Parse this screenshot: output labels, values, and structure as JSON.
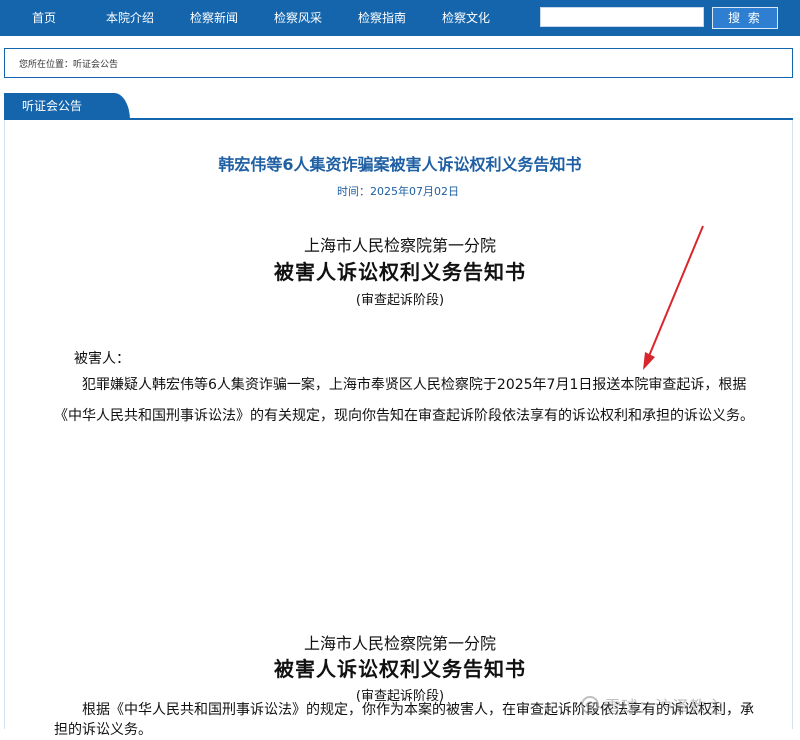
{
  "nav": {
    "items": [
      "首页",
      "本院介绍",
      "检察新闻",
      "检察风采",
      "检察指南",
      "检察文化"
    ],
    "search_placeholder": "",
    "search_label": "搜 索"
  },
  "breadcrumb": "您所在位置：听证会公告",
  "section_tab": "听证会公告",
  "article": {
    "title": "韩宏伟等6人集资诈骗案被害人诉讼权利义务告知书",
    "date": "时间：2025年07月02日",
    "block1": {
      "org": "上海市人民检察院第一分院",
      "doc_title": "被害人诉讼权利义务告知书",
      "stage": "(审查起诉阶段)",
      "victim_label": "被害人：",
      "body": "犯罪嫌疑人韩宏伟等6人集资诈骗一案，上海市奉贤区人民检察院于2025年7月1日报送本院审查起诉，根据《中华人民共和国刑事诉讼法》的有关规定，现向你告知在审查起诉阶段依法享有的诉讼权利和承担的诉讼义务。"
    },
    "block2": {
      "org": "上海市人民检察院第一分院",
      "doc_title": "被害人诉讼权利义务告知书",
      "stage": "(审查起诉阶段)",
      "body": "根据《中华人民共和国刑事诉讼法》的规定，你作为本案的被害人，在审查起诉阶段依法享有的诉讼权利，承担的诉讼义务。"
    }
  },
  "watermark": "雪球：沪泽教主",
  "colors": {
    "nav": "#1565ad",
    "title": "#1f5fa3",
    "arrow": "#d9262c"
  }
}
